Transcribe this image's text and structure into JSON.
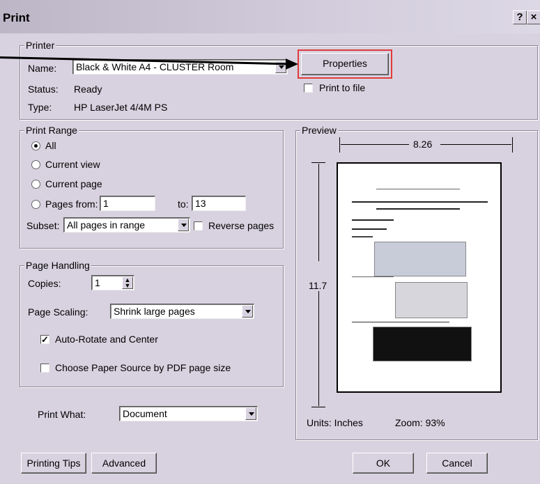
{
  "title": "Print",
  "titlebar": {
    "help": "?",
    "close": "×"
  },
  "printer": {
    "legend": "Printer",
    "name_label": "Name:",
    "name_value": "Black & White A4 - CLUSTER Room",
    "status_label": "Status:",
    "status_value": "Ready",
    "type_label": "Type:",
    "type_value": "HP LaserJet 4/4M PS",
    "properties": "Properties",
    "print_to_file": "Print to file"
  },
  "range": {
    "legend": "Print Range",
    "all": "All",
    "current_view": "Current view",
    "current_page": "Current page",
    "pages_from": "Pages from:",
    "from_value": "1",
    "to_label": "to:",
    "to_value": "13",
    "subset_label": "Subset:",
    "subset_value": "All pages in range",
    "reverse": "Reverse pages"
  },
  "handling": {
    "legend": "Page Handling",
    "copies_label": "Copies:",
    "copies_value": "1",
    "scaling_label": "Page Scaling:",
    "scaling_value": "Shrink large pages",
    "auto_rotate": "Auto-Rotate and Center",
    "choose_source": "Choose Paper Source by PDF page size"
  },
  "print_what": {
    "label": "Print What:",
    "value": "Document"
  },
  "preview": {
    "legend": "Preview",
    "width": "8.26",
    "height": "11.7",
    "units": "Units: Inches",
    "zoom": "Zoom:  93%"
  },
  "buttons": {
    "tips": "Printing Tips",
    "advanced": "Advanced",
    "ok": "OK",
    "cancel": "Cancel"
  }
}
